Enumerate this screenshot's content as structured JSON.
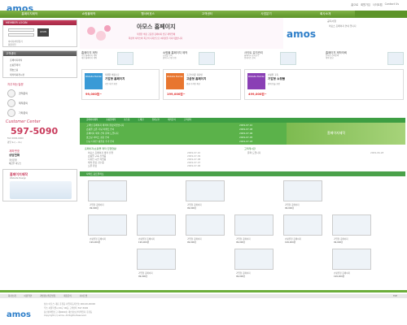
{
  "top": {
    "logo": "amos",
    "links": [
      "홈으로",
      "회원가입",
      "사이트맵",
      "Contact Us"
    ]
  },
  "nav": {
    "items": [
      "홈페이지제작",
      "쇼핑몰제작",
      "웹서버호스",
      "고객센터",
      "사업분기",
      "회사소개"
    ]
  },
  "left": {
    "member_title": "MEMBER LOGIN",
    "login_btn": "LOGIN",
    "login_rows": [
      "아이디/비번찾기",
      "회원가입"
    ],
    "menu_title": "고객센터",
    "menu_items": [
      "홈페이지제작",
      "쇼핑몰제작",
      "웹호스팅",
      "제작의뢰게시판"
    ],
    "q_title": "자주하는질문",
    "q_items": [
      "견적문의",
      "제작문의",
      "기타문의"
    ],
    "cc_title": "Customer Center",
    "cc_phone": "597-5090",
    "cc_sub": "FAX 0000-0000",
    "cc_time": "평일 9시 ~ 6시",
    "cc_tel2": "상담전화",
    "bank_title": "계좌번호",
    "bank_l1": "국민은행",
    "bank_l2": "예금주 아모스",
    "cta": "홈페이지제작",
    "cta_sub": "Website Design"
  },
  "hero": {
    "big": "아모스 홈페이지",
    "sub1": "저렴한 비용 고품질 홈페이지 전문 제작업체",
    "sub2": "최상의 서비스와 최고의 디자인으로 여러분을 기다리겠습니다",
    "logo": "amos"
  },
  "notice": {
    "title": "공지사항",
    "rows": [
      "아모스 홈페이지 안내 입니다"
    ]
  },
  "features": [
    {
      "title": "홈페이지 제작",
      "d1": "기업 홈페이지 제작",
      "d2": "개인 홈페이지 제작"
    },
    {
      "title": "쇼핑몰 홈페이지 제작",
      "d1": "쇼핑몰 구축",
      "d2": "결제 시스템 연동"
    },
    {
      "title": "사이트 유지관리",
      "d1": "홈페이지 유지보수",
      "d2": "업데이트 관리"
    },
    {
      "title": "홈페이지 제작의뢰",
      "d1": "온라인 견적문의",
      "d2": "제작 상담"
    }
  ],
  "builders": [
    {
      "box": "Website Builder",
      "t1": "저렴한 비용으로",
      "t2": "기업형 홈페이지",
      "t3": "기본 사양 포함",
      "price": "99,000원~",
      "color": "#3a9ad6"
    },
    {
      "box": "Website Builder",
      "t1": "고급스러운 디자인",
      "t2": "고급형 홈페이지",
      "t3": "맞춤 디자인 제공",
      "price": "199,000원~",
      "color": "#e8762f"
    },
    {
      "box": "Website Builder",
      "t1": "쇼핑몰 구축",
      "t2": "기업형 쇼핑몰",
      "t3": "결제 모듈 포함",
      "price": "499,000원~",
      "color": "#8a3fb5"
    }
  ],
  "newsbar": {
    "items": [
      "홈페이지제작",
      "쇼핑몰제작",
      "호스팅",
      "도메인",
      "유지보수",
      "제작문의",
      "고객센터"
    ]
  },
  "news": {
    "rows": [
      {
        "t": "고객님 홈페이지 제작이 완료되었습니다",
        "d": "2009-07-10"
      },
      {
        "t": "쇼핑몰 오픈 기념 이벤트 안내",
        "d": "2009-07-08"
      },
      {
        "t": "홈페이지 제작 견적 문의 드립니다",
        "d": "2009-07-06"
      },
      {
        "t": "호스팅 서비스 점검 안내",
        "d": "2009-07-05"
      },
      {
        "t": "신규 디자인 템플릿 추가 안내",
        "d": "2009-07-03"
      }
    ],
    "banner": "홈페이지제작"
  },
  "lists": {
    "left_title": "홈페이지/쇼핑몰 제작 진행현황",
    "left_rows": [
      {
        "t": "아모스 홈페이지 제작 진행",
        "d": "2009-07-10"
      },
      {
        "t": "쇼핑몰 구축 진행중",
        "d": "2009-07-09"
      },
      {
        "t": "디자인 시안 작업중",
        "d": "2009-07-08"
      },
      {
        "t": "제작 완료 검수중",
        "d": "2009-07-07"
      },
      {
        "t": "오픈 완료",
        "d": "2009-07-06"
      }
    ],
    "right_title": "고객게시판",
    "right_rows": [
      {
        "t": "문의 드립니다",
        "d": "2009-06-28"
      }
    ]
  },
  "products": {
    "bar": "사이트 포트폴리오",
    "items": [
      {
        "t": "기업형 홈페이지",
        "p": "99,000원"
      },
      {
        "t": "기업형 홈페이지",
        "p": "99,000원"
      },
      {
        "t": "기업형 홈페이지",
        "p": "99,000원"
      },
      {
        "t": "쇼핑몰형 홈페이지",
        "p": "199,000원"
      },
      {
        "t": "기업형 홈페이지",
        "p": "99,000원"
      },
      {
        "t": "기업형 홈페이지",
        "p": "99,000원"
      },
      {
        "t": "쇼핑몰형 홈페이지",
        "p": "199,000원"
      },
      {
        "t": "기업형 홈페이지",
        "p": "99,000원"
      },
      {
        "t": "쇼핑몰형 홈페이지",
        "p": "199,000원"
      },
      {
        "t": "기업형 홈페이지",
        "p": "99,000원"
      },
      {
        "t": "기업형 홈페이지",
        "p": "99,000원"
      },
      {
        "t": "쇼핑몰형 홈페이지",
        "p": "199,000원"
      }
    ]
  },
  "footer": {
    "nav": [
      "회사소개",
      "이용약관",
      "개인정보취급방침",
      "제휴문의",
      "사이트맵"
    ],
    "top": "TOP",
    "logo": "amos",
    "l1": "상호 아모스 대표 홍길동 사업자등록번호 000-00-00000",
    "l2": "주소 서울특별시 00구 00동 고객센터 597-5090",
    "l3": "통신판매업신고 제0000호 개인정보관리책임자 홍길동",
    "l4": "Copyright (c) amos. All Rights Reserved."
  }
}
